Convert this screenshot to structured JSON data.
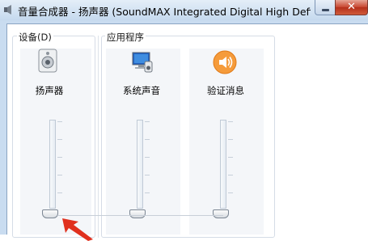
{
  "window": {
    "title": "音量合成器 - 扬声器 (SoundMAX Integrated Digital High Definition A...",
    "min_icon": "minimize-icon",
    "close_icon": "close-icon",
    "close_glyph": "✕"
  },
  "device_group": {
    "label": "设备(D)",
    "devices": [
      {
        "name": "扬声器",
        "icon": "speaker-icon",
        "level": 0.0
      }
    ]
  },
  "apps_group": {
    "label": "应用程序",
    "apps": [
      {
        "name": "系统声音",
        "icon": "system-sounds-icon",
        "level": 0.0
      },
      {
        "name": "验证消息",
        "icon": "notification-sound-icon",
        "level": 0.0
      }
    ]
  },
  "annotation": {
    "icon": "red-arrow-icon",
    "color": "#e0301e"
  }
}
